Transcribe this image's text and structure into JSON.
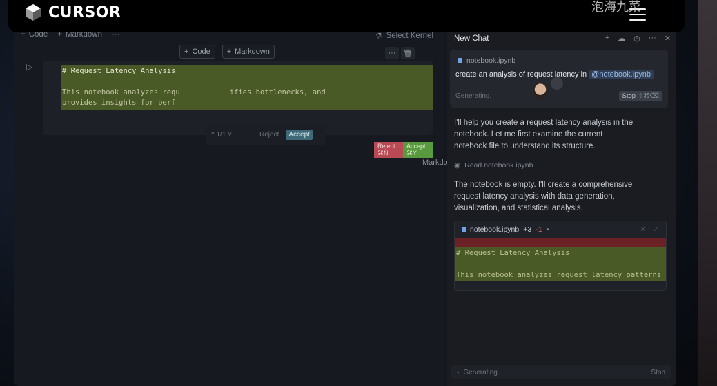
{
  "brand": {
    "name": "CURSOR",
    "watermark": "泡海九菜",
    "watermark_logo": "bilibili"
  },
  "notebook": {
    "toolbar": {
      "code_label": "Code",
      "markdown_label": "Markdown",
      "more_label": "···",
      "kernel_label": "Select Kernel"
    },
    "cell_add": {
      "code_label": "Code",
      "markdown_label": "Markdown"
    },
    "cell_actions": {
      "more_label": "···",
      "delete_icon": "trash-icon"
    },
    "cell": {
      "heading": "# Request Latency Analysis",
      "line1": "This notebook analyzes requ",
      "line1_tail": "ifies bottlenecks, and",
      "line2": "provides insights for perf",
      "language": "Markdown"
    },
    "inline_review": {
      "nav": "^ 1/1 ˅",
      "reject_label": "Reject",
      "accept_label": "Accept"
    },
    "diff_actions": {
      "reject_label": "Reject ⌘N",
      "accept_label": "Accept ⌘Y"
    }
  },
  "chat": {
    "title": "New Chat",
    "header_icons": [
      "plus-icon",
      "cloud-icon",
      "history-icon",
      "more-icon",
      "close-icon"
    ],
    "prompt": {
      "file": "notebook.ipynb",
      "text": "create an analysis of request latency in",
      "mention": "@notebook.ipynb",
      "status": "Generating.",
      "stop_label": "Stop",
      "stop_shortcut": "⇧⌘⌫"
    },
    "messages": {
      "m1": "I'll help you create a request latency analysis in the notebook. Let me first examine the current notebook file to understand its structure.",
      "read_action": "Read notebook.ipynb",
      "m2": "The notebook is empty. I'll create a comprehensive request latency analysis with data generation, visualization, and statistical analysis."
    },
    "code_card": {
      "file": "notebook.ipynb",
      "added": "+3",
      "removed": "-1",
      "dot": "•",
      "line1": "# Request Latency Analysis",
      "line2": "This notebook analyzes request latency patterns"
    },
    "bottom": {
      "status": "Generating.",
      "stop_label": "Stop"
    }
  }
}
